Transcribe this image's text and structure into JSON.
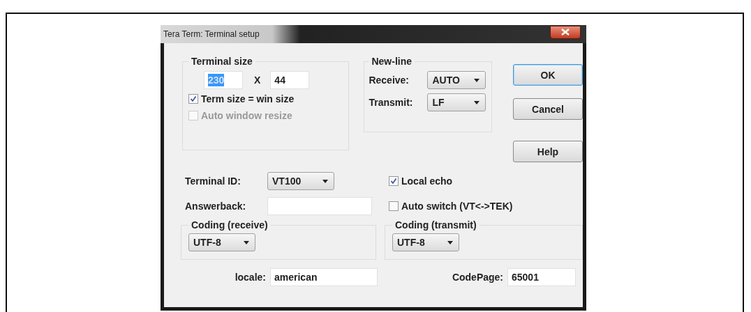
{
  "window": {
    "title": "Tera Term: Terminal setup"
  },
  "terminal_size": {
    "title": "Terminal size",
    "columns": "230",
    "columns_selected": true,
    "separator": "X",
    "rows": "44",
    "options": [
      {
        "label": "Term size = win size",
        "checked": true,
        "disabled": false
      },
      {
        "label": "Auto window resize",
        "checked": false,
        "disabled": true
      }
    ]
  },
  "new_line": {
    "title": "New-line",
    "fields": [
      {
        "label": "Receive:",
        "value": "AUTO"
      },
      {
        "label": "Transmit:",
        "value": "LF"
      }
    ]
  },
  "buttons": [
    {
      "label": "OK",
      "default": true
    },
    {
      "label": "Cancel",
      "default": false
    },
    {
      "label": "Help",
      "default": false
    }
  ],
  "terminal_id": {
    "label": "Terminal ID:",
    "value": "VT100"
  },
  "answerback": {
    "label": "Answerback:"
  },
  "checks": [
    {
      "label": "Local echo",
      "checked": true
    },
    {
      "label": "Auto switch (VT<->TEK)",
      "checked": false
    }
  ],
  "coding": [
    {
      "title": "Coding (receive)",
      "value": "UTF-8"
    },
    {
      "title": "Coding (transmit)",
      "value": "UTF-8"
    }
  ],
  "locale": {
    "label": "locale:",
    "value": "american"
  },
  "codepage": {
    "label": "CodePage:",
    "value": "65001"
  }
}
